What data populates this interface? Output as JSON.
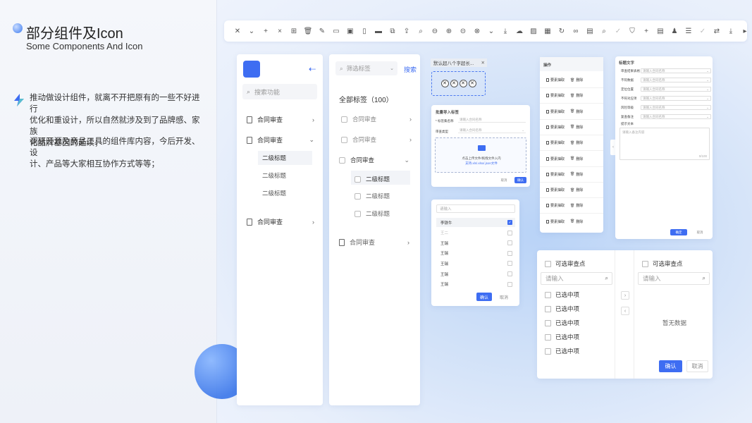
{
  "left": {
    "title": "部分组件及Icon",
    "subtitle": "Some Components And Icon",
    "para1_lines": [
      "推动做设计组件，就离不开把原有的一些不好进行",
      "优化和重设计，所以自然就涉及到了品牌感、家族",
      "化品牌基因的延续；"
    ],
    "para2_lines": [
      "调研开源及竞品工具的组件库内容，今后开发、设",
      "计、产品等大家相互协作方式等等；"
    ]
  },
  "toolbar": {
    "icons": [
      "close-icon",
      "chevron-down-icon",
      "plus-icon",
      "x-icon",
      "plus-square-icon",
      "trash-icon",
      "edit-icon",
      "card-icon",
      "folder-icon",
      "file-icon",
      "minus-square-icon",
      "copy-icon",
      "upload-icon",
      "search-icon",
      "zoom-out-icon",
      "zoom-in-icon",
      "minus-circle-icon",
      "close-circle-icon",
      "double-chevron-down-icon",
      "download-icon",
      "cloud-upload-icon",
      "image-icon",
      "gallery-icon",
      "refresh-icon",
      "link-icon",
      "folder-plus-icon",
      "search-small-icon",
      "check-icon",
      "shield-icon",
      "plus-small-icon",
      "document-icon",
      "user-icon",
      "layers-icon",
      "check-small-icon",
      "swap-icon",
      "download-tray-icon",
      "play-icon"
    ],
    "glyphs": [
      "✕",
      "⌄",
      "+",
      "×",
      "⊞",
      "🗑",
      "✎",
      "▭",
      "▣",
      "▯",
      "▬",
      "⧉",
      "⇪",
      "⌕",
      "⊖",
      "⊕",
      "⊝",
      "⊗",
      "⌄",
      "⤓",
      "☁",
      "▨",
      "▦",
      "↻",
      "∞",
      "▤",
      "⌕",
      "✓",
      "⛉",
      "+",
      "▤",
      "♟",
      "☰",
      "✓",
      "⇄",
      "⤓",
      "▸"
    ]
  },
  "nav": {
    "search_placeholder": "搜索功能",
    "items": [
      {
        "label": "合同审查",
        "chev": "›"
      },
      {
        "label": "合同审查",
        "chev": "⌄"
      },
      {
        "label": "合同审查",
        "chev": "›"
      }
    ],
    "subs": [
      "二级标题",
      "二级标题",
      "二级标题"
    ]
  },
  "tree": {
    "search_placeholder": "筛选标签",
    "search_btn": "搜索",
    "all_tags": "全部标签（100）",
    "rows": [
      {
        "label": "合同审查",
        "chev": "›"
      },
      {
        "label": "合同审查",
        "chev": "›"
      },
      {
        "label": "合同审查",
        "chev": "⌄"
      }
    ],
    "subs": [
      "二级标题",
      "二级标题",
      "二级标题"
    ],
    "last": {
      "label": "合同审查",
      "chev": "›"
    }
  },
  "tag": {
    "input_text": "默认超八个字超长...",
    "close": "✕",
    "chips": [
      "✕",
      "✕",
      "✕",
      "✕"
    ]
  },
  "batch": {
    "title": "批量导入标签",
    "field1_label": "* 标签集名称",
    "field1_placeholder": "请输入合同名称",
    "field2_label": "审查类型",
    "field2_placeholder": "请输入合同名称",
    "upload_text": "点击上传文件/拖拽文件入内",
    "upload_hint": "支持.xls/.xlsx/.json文件",
    "cancel": "取消",
    "ok": "确认"
  },
  "actions": {
    "title": "操作",
    "rows": [
      "要素抽取",
      "要素抽取",
      "要素抽取",
      "要素抽取",
      "要素抽取",
      "要素抽取",
      "要素抽取",
      "要素抽取",
      "要素抽取",
      "要素抽取"
    ],
    "delete": "删除"
  },
  "form": {
    "title": "标题文字",
    "rows": [
      {
        "label": "审查结果表格",
        "ph": "请输入合同名称"
      },
      {
        "label": "不符数据",
        "ph": "请输入合同名称"
      },
      {
        "label": "定位位置",
        "ph": "请输入合同名称"
      },
      {
        "label": "不符对应项",
        "ph": "请输入合同名称"
      },
      {
        "label": "风险等级",
        "ph": "请输入合同名称"
      },
      {
        "label": "复查备注",
        "ph": "请输入合同名称"
      }
    ],
    "textarea_label": "提示文本",
    "textarea_ph": "请输入备注内容",
    "count": "0/100",
    "ok": "确定",
    "cancel": "取消"
  },
  "dropdown": {
    "placeholder": "请输入",
    "rows": [
      {
        "label": "李铁牛",
        "state": "sel"
      },
      {
        "label": "王二",
        "state": "dis"
      },
      {
        "label": "王瑞",
        "state": ""
      },
      {
        "label": "王瑞",
        "state": ""
      },
      {
        "label": "王瑞",
        "state": ""
      },
      {
        "label": "王瑞",
        "state": ""
      },
      {
        "label": "王瑞",
        "state": ""
      }
    ],
    "ok": "确认",
    "cancel": "取消"
  },
  "transfer": {
    "left_title": "可选审查点",
    "right_title": "可选审查点",
    "placeholder": "请输入",
    "items": [
      "已选中项",
      "已选中项",
      "已选中项",
      "已选中项",
      "已选中项"
    ],
    "empty": "暂无数据",
    "ok": "确认",
    "cancel": "取消",
    "to_right": "›",
    "to_left": "‹"
  }
}
